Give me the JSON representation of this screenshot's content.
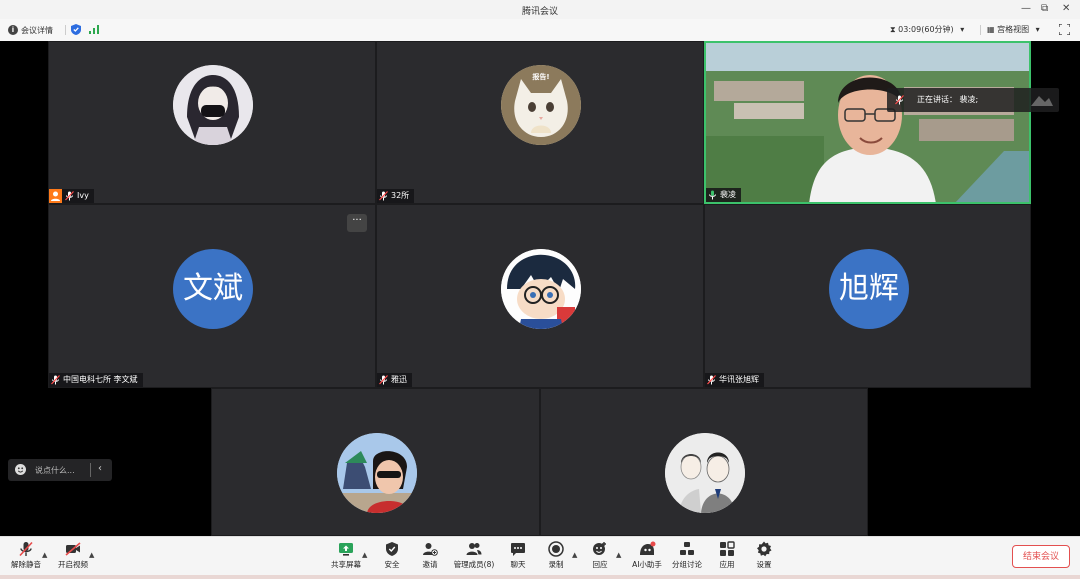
{
  "window": {
    "title": "腾讯会议",
    "minimize": "—",
    "restore": "⧉",
    "close": "✕"
  },
  "infobar": {
    "meeting_details": "会议详情",
    "timer": "03:09(60分钟)",
    "view_mode": "宫格视图"
  },
  "speaking": {
    "label": "正在讲话：",
    "name": "裴凌;"
  },
  "tiles": [
    {
      "name": "Ivy",
      "host": true
    },
    {
      "name": "32所",
      "avatar_text": "报告!"
    },
    {
      "name": "裴凌",
      "active": true
    },
    {
      "name": "中国电科七所 李文斌",
      "avatar_text": "文斌"
    },
    {
      "name": "雅迅"
    },
    {
      "name": "华讯张旭辉",
      "avatar_text": "旭辉"
    },
    {
      "name": ""
    },
    {
      "name": ""
    }
  ],
  "chat": {
    "placeholder": "说点什么..."
  },
  "toolbar": {
    "unmute": "解除静音",
    "video": "开启视频",
    "share": "共享屏幕",
    "security": "安全",
    "invite": "邀请",
    "members": "管理成员(8)",
    "chat": "聊天",
    "record": "录制",
    "react": "回应",
    "ai": "AI小助手",
    "breakout": "分组讨论",
    "apps": "应用",
    "settings": "设置",
    "end": "结束会议"
  },
  "colors": {
    "accent": "#3b73c5",
    "active_border": "#3cc26b",
    "end_red": "#e35050",
    "host_badge": "#ff7a1a"
  }
}
